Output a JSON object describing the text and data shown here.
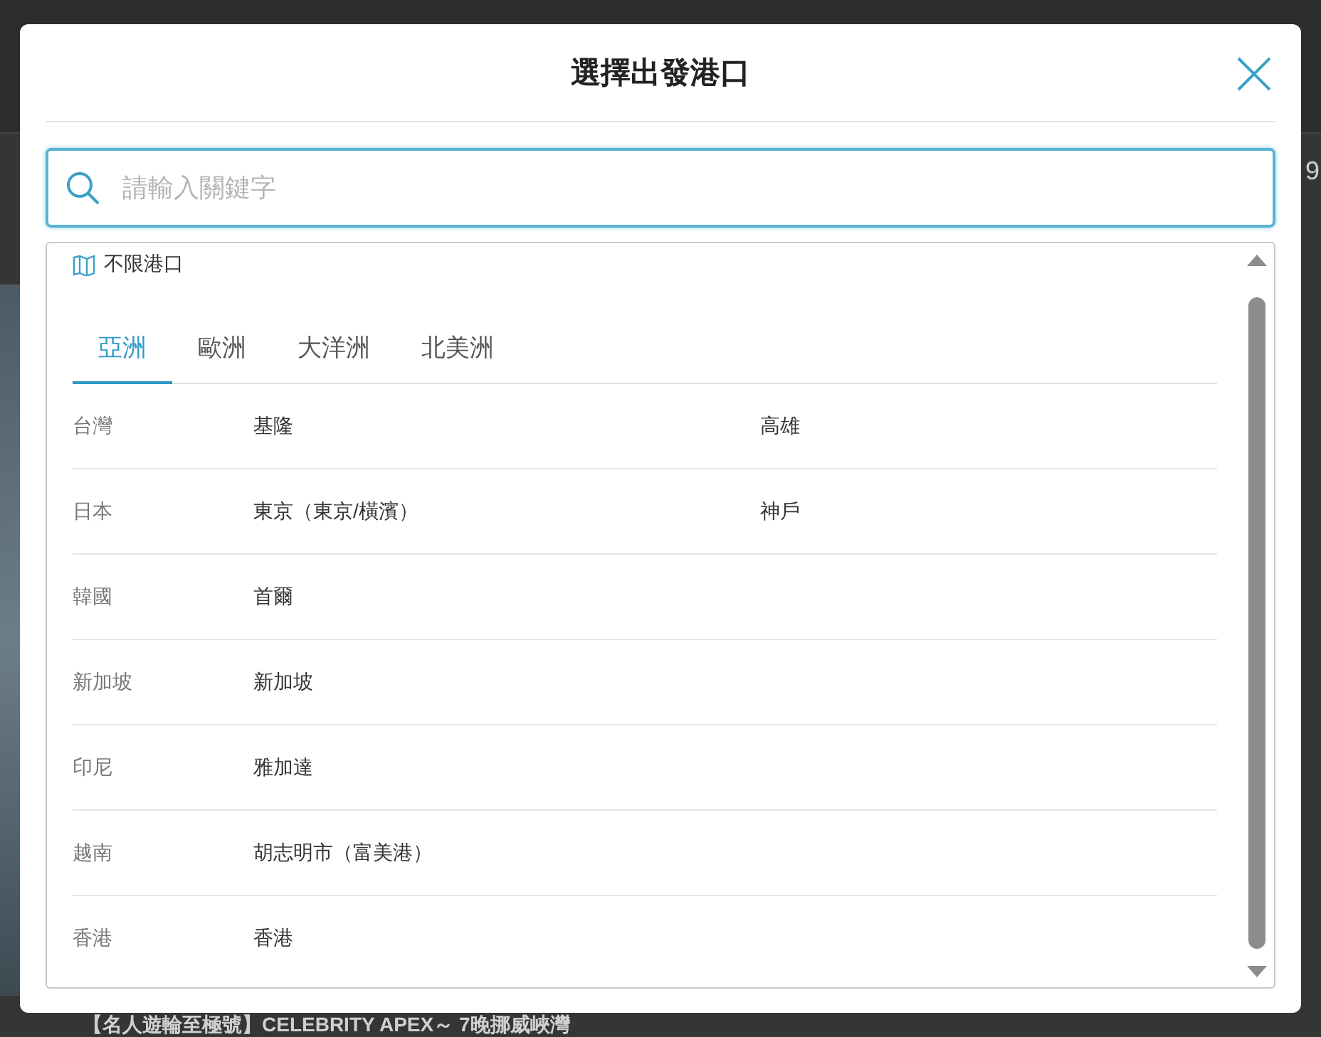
{
  "background": {
    "side_text": "9",
    "article_title": "【名人遊輪至極號】CELEBRITY APEX～ 7晚挪威峽灣"
  },
  "dialog": {
    "title": "選擇出發港口",
    "search": {
      "placeholder": "請輸入關鍵字"
    },
    "any_port": "不限港口",
    "tabs": [
      {
        "label": "亞洲",
        "selected": true
      },
      {
        "label": "歐洲",
        "selected": false
      },
      {
        "label": "大洋洲",
        "selected": false
      },
      {
        "label": "北美洲",
        "selected": false
      }
    ],
    "rows": [
      {
        "region": "台灣",
        "ports": [
          "基隆",
          "高雄"
        ]
      },
      {
        "region": "日本",
        "ports": [
          "東京（東京/橫濱）",
          "神戶"
        ]
      },
      {
        "region": "韓國",
        "ports": [
          "首爾"
        ]
      },
      {
        "region": "新加坡",
        "ports": [
          "新加坡"
        ]
      },
      {
        "region": "印尼",
        "ports": [
          "雅加達"
        ]
      },
      {
        "region": "越南",
        "ports": [
          "胡志明市（富美港）"
        ]
      },
      {
        "region": "香港",
        "ports": [
          "香港"
        ]
      }
    ]
  }
}
